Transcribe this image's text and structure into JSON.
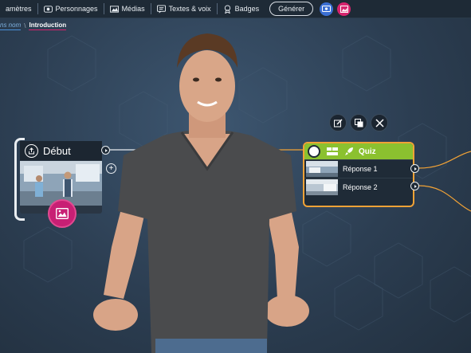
{
  "toolbar": {
    "items": [
      {
        "label": "amètres",
        "icon": "settings-icon"
      },
      {
        "label": "Personnages",
        "icon": "characters-icon"
      },
      {
        "label": "Médias",
        "icon": "media-icon"
      },
      {
        "label": "Textes & voix",
        "icon": "text-voice-icon"
      },
      {
        "label": "Badges",
        "icon": "badge-icon"
      }
    ],
    "generate_label": "Générer",
    "colors": {
      "blue_button": "#3b6fd4",
      "pink_button": "#d6246e"
    }
  },
  "breadcrumb": {
    "previous": "ns nom",
    "separator": "\\",
    "current": "Introduction"
  },
  "nodes": {
    "start": {
      "title": "Début",
      "icon": "export-icon"
    },
    "quiz": {
      "title": "Quiz",
      "header_color": "#8bc12f",
      "border_color": "#f1a236",
      "answers": [
        "Réponse 1",
        "Réponse 2"
      ]
    }
  },
  "tools": [
    "edit-icon",
    "duplicate-icon",
    "close-icon"
  ]
}
